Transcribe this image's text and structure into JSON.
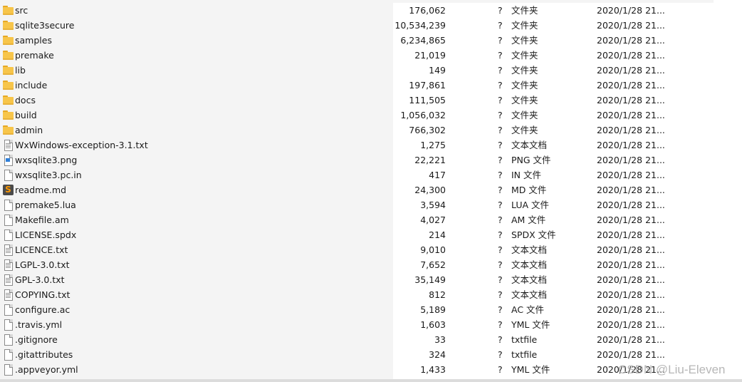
{
  "rows": [
    {
      "name": "src",
      "size": "176,062",
      "q": "?",
      "type": "文件夹",
      "date": "2020/1/28 21...",
      "icon": "folder-icon"
    },
    {
      "name": "sqlite3secure",
      "size": "10,534,239",
      "q": "?",
      "type": "文件夹",
      "date": "2020/1/28 21...",
      "icon": "folder-icon"
    },
    {
      "name": "samples",
      "size": "6,234,865",
      "q": "?",
      "type": "文件夹",
      "date": "2020/1/28 21...",
      "icon": "folder-icon"
    },
    {
      "name": "premake",
      "size": "21,019",
      "q": "?",
      "type": "文件夹",
      "date": "2020/1/28 21...",
      "icon": "folder-icon"
    },
    {
      "name": "lib",
      "size": "149",
      "q": "?",
      "type": "文件夹",
      "date": "2020/1/28 21...",
      "icon": "folder-icon"
    },
    {
      "name": "include",
      "size": "197,861",
      "q": "?",
      "type": "文件夹",
      "date": "2020/1/28 21...",
      "icon": "folder-icon"
    },
    {
      "name": "docs",
      "size": "111,505",
      "q": "?",
      "type": "文件夹",
      "date": "2020/1/28 21...",
      "icon": "folder-icon"
    },
    {
      "name": "build",
      "size": "1,056,032",
      "q": "?",
      "type": "文件夹",
      "date": "2020/1/28 21...",
      "icon": "folder-icon"
    },
    {
      "name": "admin",
      "size": "766,302",
      "q": "?",
      "type": "文件夹",
      "date": "2020/1/28 21...",
      "icon": "folder-icon"
    },
    {
      "name": "WxWindows-exception-3.1.txt",
      "size": "1,275",
      "q": "?",
      "type": "文本文档",
      "date": "2020/1/28 21...",
      "icon": "text-file-icon"
    },
    {
      "name": "wxsqlite3.png",
      "size": "22,221",
      "q": "?",
      "type": "PNG 文件",
      "date": "2020/1/28 21...",
      "icon": "image-file-icon"
    },
    {
      "name": "wxsqlite3.pc.in",
      "size": "417",
      "q": "?",
      "type": "IN 文件",
      "date": "2020/1/28 21...",
      "icon": "file-icon"
    },
    {
      "name": "readme.md",
      "size": "24,300",
      "q": "?",
      "type": "MD 文件",
      "date": "2020/1/28 21...",
      "icon": "sublime-text-icon"
    },
    {
      "name": "premake5.lua",
      "size": "3,594",
      "q": "?",
      "type": "LUA 文件",
      "date": "2020/1/28 21...",
      "icon": "file-icon"
    },
    {
      "name": "Makefile.am",
      "size": "4,027",
      "q": "?",
      "type": "AM 文件",
      "date": "2020/1/28 21...",
      "icon": "file-icon"
    },
    {
      "name": "LICENSE.spdx",
      "size": "214",
      "q": "?",
      "type": "SPDX 文件",
      "date": "2020/1/28 21...",
      "icon": "file-icon"
    },
    {
      "name": "LICENCE.txt",
      "size": "9,010",
      "q": "?",
      "type": "文本文档",
      "date": "2020/1/28 21...",
      "icon": "text-file-icon"
    },
    {
      "name": "LGPL-3.0.txt",
      "size": "7,652",
      "q": "?",
      "type": "文本文档",
      "date": "2020/1/28 21...",
      "icon": "text-file-icon"
    },
    {
      "name": "GPL-3.0.txt",
      "size": "35,149",
      "q": "?",
      "type": "文本文档",
      "date": "2020/1/28 21...",
      "icon": "text-file-icon"
    },
    {
      "name": "COPYING.txt",
      "size": "812",
      "q": "?",
      "type": "文本文档",
      "date": "2020/1/28 21...",
      "icon": "text-file-icon"
    },
    {
      "name": "configure.ac",
      "size": "5,189",
      "q": "?",
      "type": "AC 文件",
      "date": "2020/1/28 21...",
      "icon": "file-icon"
    },
    {
      "name": ".travis.yml",
      "size": "1,603",
      "q": "?",
      "type": "YML 文件",
      "date": "2020/1/28 21...",
      "icon": "file-icon"
    },
    {
      "name": ".gitignore",
      "size": "33",
      "q": "?",
      "type": "txtfile",
      "date": "2020/1/28 21...",
      "icon": "file-icon"
    },
    {
      "name": ".gitattributes",
      "size": "324",
      "q": "?",
      "type": "txtfile",
      "date": "2020/1/28 21...",
      "icon": "file-icon"
    },
    {
      "name": ".appveyor.yml",
      "size": "1,433",
      "q": "?",
      "type": "YML 文件",
      "date": "2020/1/28 21...",
      "icon": "file-icon"
    }
  ],
  "watermark": "CSDN @Liu-Eleven",
  "colors": {
    "name_column_bg": "#f4f4f4",
    "folder": "#f7c54a",
    "sublime_orange": "#ff9800"
  }
}
